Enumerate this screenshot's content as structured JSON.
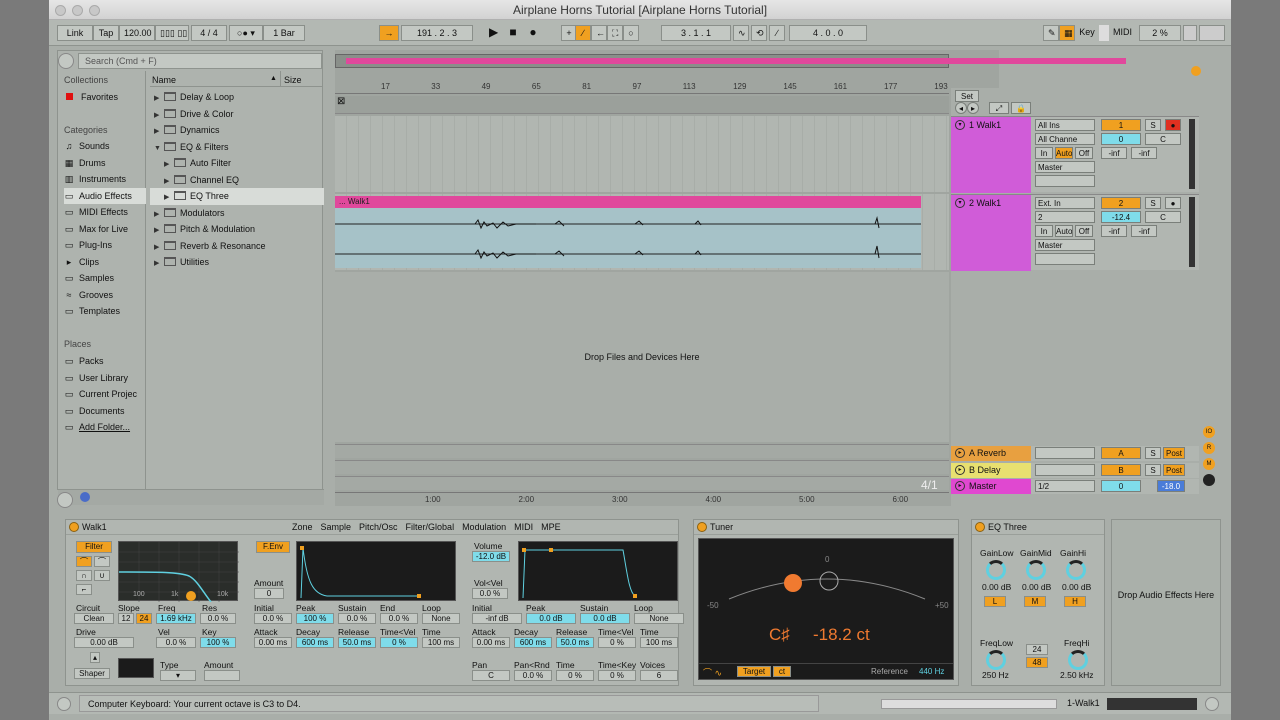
{
  "window": {
    "title": "Airplane Horns Tutorial  [Airplane Horns Tutorial]"
  },
  "toolbar": {
    "link": "Link",
    "tap": "Tap",
    "tempo": "120.00",
    "signature": "4 / 4",
    "quantize": "1 Bar",
    "position": "191 .  2 .  3",
    "loop_start": "3 .  1 .  1",
    "loop_length": "4 .  0 .  0",
    "key": "Key",
    "midi": "MIDI",
    "cpu": "2 %"
  },
  "browser": {
    "search_placeholder": "Search (Cmd + F)",
    "collections_header": "Collections",
    "favorites": "Favorites",
    "categories_header": "Categories",
    "categories": [
      "Sounds",
      "Drums",
      "Instruments",
      "Audio Effects",
      "MIDI Effects",
      "Max for Live",
      "Plug-Ins",
      "Clips",
      "Samples",
      "Grooves",
      "Templates"
    ],
    "category_icons": [
      "note-icon",
      "grid-icon",
      "piano-icon",
      "effects-icon",
      "midi-icon",
      "max-icon",
      "plug-icon",
      "clip-icon",
      "wave-icon",
      "groove-icon",
      "template-icon"
    ],
    "places_header": "Places",
    "places": [
      "Packs",
      "User Library",
      "Current Projec",
      "Documents",
      "Add Folder..."
    ],
    "col_name": "Name",
    "col_size": "Size",
    "items": [
      {
        "label": "Delay & Loop",
        "indent": 0
      },
      {
        "label": "Drive & Color",
        "indent": 0
      },
      {
        "label": "Dynamics",
        "indent": 0
      },
      {
        "label": "EQ & Filters",
        "indent": 0
      },
      {
        "label": "Auto Filter",
        "indent": 1
      },
      {
        "label": "Channel EQ",
        "indent": 1
      },
      {
        "label": "EQ Three",
        "indent": 1
      },
      {
        "label": "Modulators",
        "indent": 0
      },
      {
        "label": "Pitch & Modulation",
        "indent": 0
      },
      {
        "label": "Reverb & Resonance",
        "indent": 0
      },
      {
        "label": "Utilities",
        "indent": 0
      }
    ]
  },
  "arrangement": {
    "bar_numbers": [
      "17",
      "33",
      "49",
      "65",
      "81",
      "97",
      "113",
      "129",
      "145",
      "161",
      "177",
      "193"
    ],
    "time_labels": [
      "1:00",
      "2:00",
      "3:00",
      "4:00",
      "5:00",
      "6:00"
    ],
    "clip_name": "... Walk1",
    "drop_text": "Drop Files and Devices Here",
    "zoom": "4/1",
    "set_label": "Set"
  },
  "tracks": [
    {
      "name": "1 Walk1",
      "input": "All Ins",
      "channel": "All Channe",
      "monitor": [
        "In",
        "Auto",
        "Off"
      ],
      "output": "Master",
      "number": "1",
      "volume": "0",
      "pan": "C",
      "peak_l": "-inf",
      "peak_r": "-inf"
    },
    {
      "name": "2 Walk1",
      "input": "Ext. In",
      "channel": "2",
      "monitor": [
        "In",
        "Auto",
        "Off"
      ],
      "output": "Master",
      "number": "2",
      "volume": "-12.4",
      "pan": "C",
      "peak_l": "-inf",
      "peak_r": "-inf"
    }
  ],
  "returns": [
    {
      "name": "A Reverb",
      "letter": "A",
      "s": "S",
      "post": "Post"
    },
    {
      "name": "B Delay",
      "letter": "B",
      "s": "S",
      "post": "Post"
    },
    {
      "name": "Master",
      "cue": "1/2",
      "volume": "0",
      "peak": "-18.0"
    }
  ],
  "simpler": {
    "name": "Walk1",
    "tabs": [
      "Zone",
      "Sample",
      "Pitch/Osc",
      "Filter/Global",
      "Modulation",
      "MIDI",
      "MPE"
    ],
    "filter_btn": "Filter",
    "fenv_btn": "F.Env",
    "filter_axis": [
      "100",
      "1k",
      "10k"
    ],
    "circuit_label": "Circuit",
    "circuit": "Clean",
    "slope_label": "Slope",
    "slope_a": "12",
    "slope_b": "24",
    "freq_label": "Freq",
    "freq": "1.69 kHz",
    "res_label": "Res",
    "res": "0.0 %",
    "drive_label": "Drive",
    "drive": "0.00 dB",
    "vel_label": "Vel",
    "vel": "0.0 %",
    "key_label": "Key",
    "key": "100 %",
    "shaper": "Shaper",
    "type_label": "Type",
    "amount_label": "Amount",
    "amount_label_f": "Amount",
    "amount_f": "0",
    "fenv": {
      "labels": [
        "Initial",
        "Peak",
        "Sustain",
        "End",
        "Loop"
      ],
      "values": [
        "0.0 %",
        "100 %",
        "0.0 %",
        "0.0 %",
        "None"
      ],
      "labels2": [
        "Attack",
        "Decay",
        "Release",
        "Time<Vel",
        "Time"
      ],
      "values2": [
        "0.00 ms",
        "600 ms",
        "50.0 ms",
        "0 %",
        "100 ms"
      ]
    },
    "volume_label": "Volume",
    "volume": "-12.0 dB",
    "volvel_label": "Vol<Vel",
    "volvel": "0.0 %",
    "aenv": {
      "labels": [
        "Initial",
        "Peak",
        "Sustain",
        "Loop"
      ],
      "values": [
        "-inf dB",
        "0.0 dB",
        "0.0 dB",
        "None"
      ],
      "labels2": [
        "Attack",
        "Decay",
        "Release",
        "Time<Vel",
        "Time"
      ],
      "values2": [
        "0.00 ms",
        "600 ms",
        "50.0 ms",
        "0 %",
        "100 ms"
      ]
    },
    "pan_row": {
      "labels": [
        "Pan",
        "Pan<Rnd",
        "Time",
        "Time<Key",
        "Voices"
      ],
      "values": [
        "C",
        "0.0 %",
        "0 %",
        "0 %",
        "6"
      ]
    }
  },
  "tuner": {
    "name": "Tuner",
    "note": "C♯",
    "cents": "-18.2 ct",
    "scale_left": "-50",
    "scale_center": "0",
    "scale_right": "+50",
    "target": "Target",
    "ct": "ct",
    "reference_label": "Reference",
    "reference": "440 Hz"
  },
  "eq": {
    "name": "EQ Three",
    "gains": [
      {
        "label": "GainLow",
        "value": "0.00 dB",
        "btn": "L"
      },
      {
        "label": "GainMid",
        "value": "0.00 dB",
        "btn": "M"
      },
      {
        "label": "GainHi",
        "value": "0.00 dB",
        "btn": "H"
      }
    ],
    "freqlow_label": "FreqLow",
    "freqlow": "250 Hz",
    "freqhi_label": "FreqHi",
    "freqhi": "2.50 kHz",
    "slope_a": "24",
    "slope_b": "48"
  },
  "drop_effects": "Drop Audio Effects Here",
  "status": {
    "message": "Computer Keyboard: Your current octave is C3 to D4.",
    "track": "1-Walk1"
  },
  "colors": {
    "accent_orange": "#f0a020",
    "clip_pink": "#e0489c",
    "track_purple": "#d05cd8",
    "cyan": "#7fdcea",
    "return_yellow": "#e8e070"
  }
}
